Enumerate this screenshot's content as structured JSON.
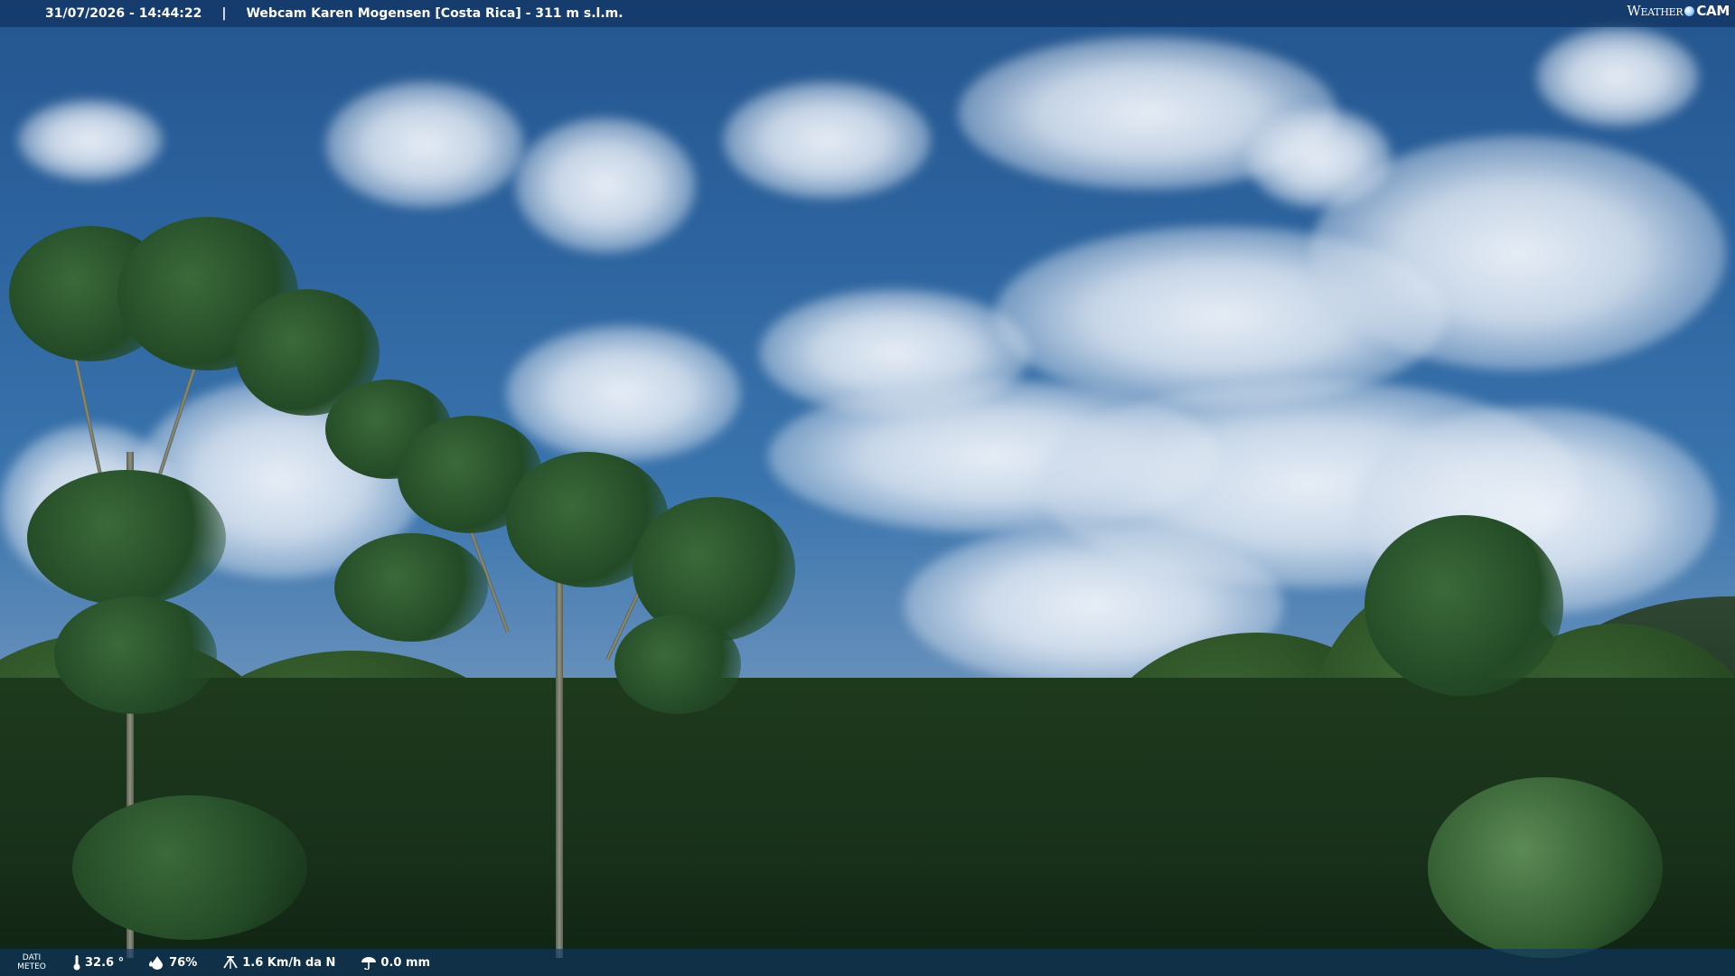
{
  "overlay": {
    "datetime": "31/07/2026 - 14:44:22",
    "separator": "|",
    "title": "Webcam Karen Mogensen [Costa Rica] - 311 m s.l.m."
  },
  "logo": {
    "part1": "Weather",
    "part2": "CAM",
    "globe_color": "#2a8ce6"
  },
  "meteo": {
    "label_line1": "DATI",
    "label_line2": "METEO",
    "temperature": "32.6 °",
    "humidity": "76%",
    "wind": "1.6 Km/h da N",
    "rain": "0.0 mm",
    "icons": [
      "thermometer-icon",
      "humidity-drop-icon",
      "wind-icon",
      "rain-icon"
    ]
  },
  "colors": {
    "sky_top": "#24558e",
    "bar_bg": "#0f3764"
  }
}
